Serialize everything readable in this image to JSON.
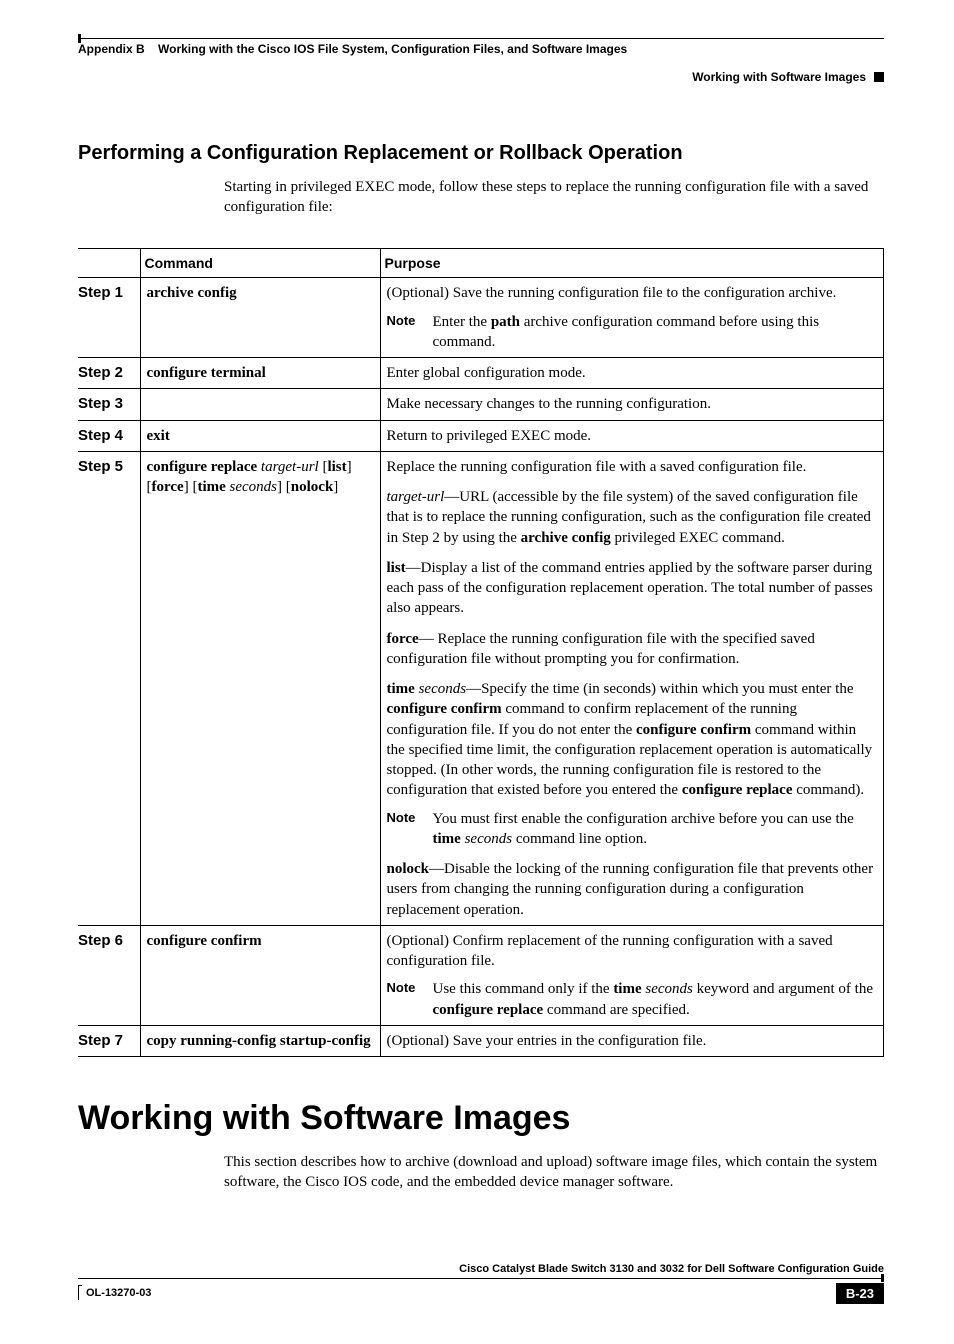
{
  "header": {
    "appendix": "Appendix B",
    "title": "Working with the Cisco IOS File System, Configuration Files, and Software Images",
    "section": "Working with Software Images"
  },
  "section": {
    "title": "Performing a Configuration Replacement or Rollback Operation",
    "intro": "Starting in privileged EXEC mode, follow these steps to replace the running configuration file with a saved configuration file:"
  },
  "table": {
    "headers": {
      "command": "Command",
      "purpose": "Purpose"
    },
    "note_label": "Note",
    "steps": [
      {
        "label": "Step 1",
        "command_html": "<b>archive config</b>",
        "purpose_html": "(Optional) Save the running configuration file to the configuration archive.",
        "note_html": "Enter the <b>path</b> archive configuration command before using this command."
      },
      {
        "label": "Step 2",
        "command_html": "<b>configure terminal</b>",
        "purpose_html": "Enter global configuration mode."
      },
      {
        "label": "Step 3",
        "command_html": "",
        "purpose_html": "Make necessary changes to the running configuration."
      },
      {
        "label": "Step 4",
        "command_html": "<b>exit</b>",
        "purpose_html": "Return to privileged EXEC mode."
      },
      {
        "label": "Step 5",
        "command_html": "<b>configure replace</b> <i>target-url</i> [<b>list</b>] [<b>force</b>] [<b>time</b> <i>seconds</i>] [<b>nolock</b>]",
        "purpose_blocks": [
          "Replace the running configuration file with a saved configuration file.",
          "<i>target-url</i>—URL (accessible by the file system) of the saved configuration file that is to replace the running configuration, such as the configuration file created in Step 2 by using the <b>archive config</b> privileged EXEC command.",
          "<b>list</b>—Display a list of the command entries applied by the software parser during each pass of the configuration replacement operation. The total number of passes also appears.",
          "<b>force</b>— Replace the running configuration file with the specified saved configuration file without prompting you for confirmation.",
          "<b>time</b> <i>seconds</i>—Specify the time (in seconds) within which you must enter the <b>configure confirm</b> command to confirm replacement of the running configuration file. If you do not enter the <b>configure confirm</b> command within the specified time limit, the configuration replacement operation is automatically stopped. (In other words, the running configuration file is restored to the configuration that existed before you entered the <b>configure replace</b> command)."
        ],
        "note_html": "You must first enable the configuration archive before you can use the <b>time</b> <i>seconds</i> command line option.",
        "purpose_blocks_after": [
          "<b>nolock</b>—Disable the locking of the running configuration file that prevents other users from changing the running configuration during a configuration replacement operation."
        ]
      },
      {
        "label": "Step 6",
        "command_html": "<b>configure confirm</b>",
        "purpose_html": "(Optional) Confirm replacement of the running configuration with a saved configuration file.",
        "note_html": "Use this command only if the <b>time</b> <i>seconds</i> keyword and argument of the <b>configure replace</b> command are specified."
      },
      {
        "label": "Step 7",
        "command_html": "<b>copy running-config startup-config</b>",
        "purpose_html": "(Optional) Save your entries in the configuration file."
      }
    ]
  },
  "major": {
    "title": "Working with Software Images",
    "intro": "This section describes how to archive (download and upload) software image files, which contain the system software, the Cisco IOS code, and the embedded device manager software."
  },
  "footer": {
    "guide": "Cisco Catalyst Blade Switch 3130 and 3032 for Dell Software Configuration Guide",
    "doc_id": "OL-13270-03",
    "page": "B-23"
  }
}
